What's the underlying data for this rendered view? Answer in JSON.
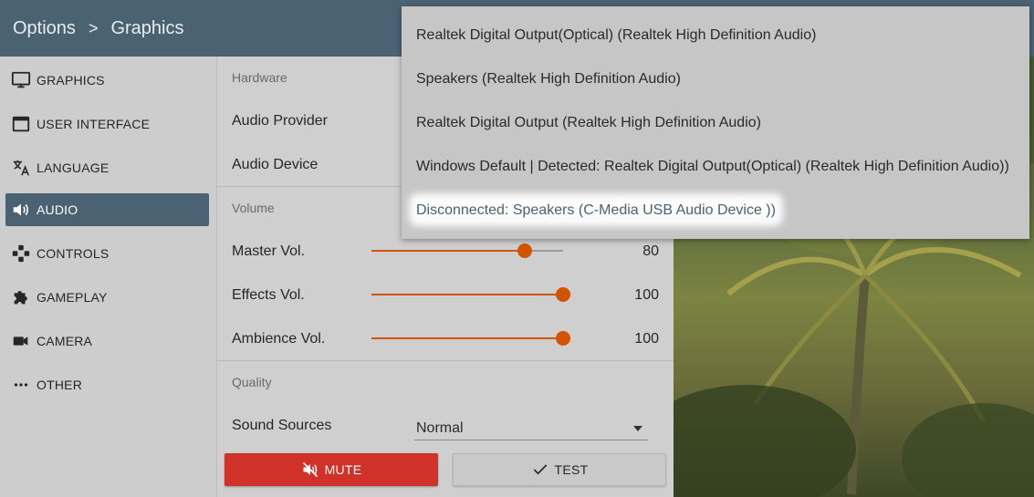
{
  "breadcrumb": {
    "root": "Options",
    "separator": ">",
    "current": "Graphics"
  },
  "sidebar": {
    "items": [
      {
        "label": "GRAPHICS",
        "icon": "monitor-icon",
        "active": false
      },
      {
        "label": "USER INTERFACE",
        "icon": "window-icon",
        "active": false
      },
      {
        "label": "LANGUAGE",
        "icon": "translate-icon",
        "active": false
      },
      {
        "label": "AUDIO",
        "icon": "speaker-icon",
        "active": true
      },
      {
        "label": "CONTROLS",
        "icon": "gamepad-icon",
        "active": false
      },
      {
        "label": "GAMEPLAY",
        "icon": "puzzle-icon",
        "active": false
      },
      {
        "label": "CAMERA",
        "icon": "camera-icon",
        "active": false
      },
      {
        "label": "OTHER",
        "icon": "more-dots-icon",
        "active": false
      }
    ]
  },
  "panel": {
    "hardware": {
      "title": "Hardware",
      "provider_label": "Audio Provider",
      "device_label": "Audio Device"
    },
    "volume": {
      "title": "Volume",
      "sliders": [
        {
          "label": "Master Vol.",
          "value": "80",
          "fraction": 0.8
        },
        {
          "label": "Effects Vol.",
          "value": "100",
          "fraction": 1.0
        },
        {
          "label": "Ambience Vol.",
          "value": "100",
          "fraction": 1.0
        }
      ]
    },
    "quality": {
      "title": "Quality",
      "sound_sources_label": "Sound Sources",
      "sound_sources_value": "Normal"
    },
    "buttons": {
      "mute": "MUTE",
      "test": "TEST"
    }
  },
  "dropdown": {
    "options": [
      "Realtek Digital Output(Optical) (Realtek High Definition Audio)",
      "Speakers (Realtek High Definition Audio)",
      "Realtek Digital Output (Realtek High Definition Audio)",
      "Windows Default | Detected: Realtek Digital Output(Optical) (Realtek High Definition Audio))",
      "Disconnected: Speakers (C-Media USB Audio Device ))"
    ],
    "highlighted_index": 4
  },
  "colors": {
    "accent": "#4a6272",
    "slider": "#d35400",
    "mute": "#d0322a"
  }
}
